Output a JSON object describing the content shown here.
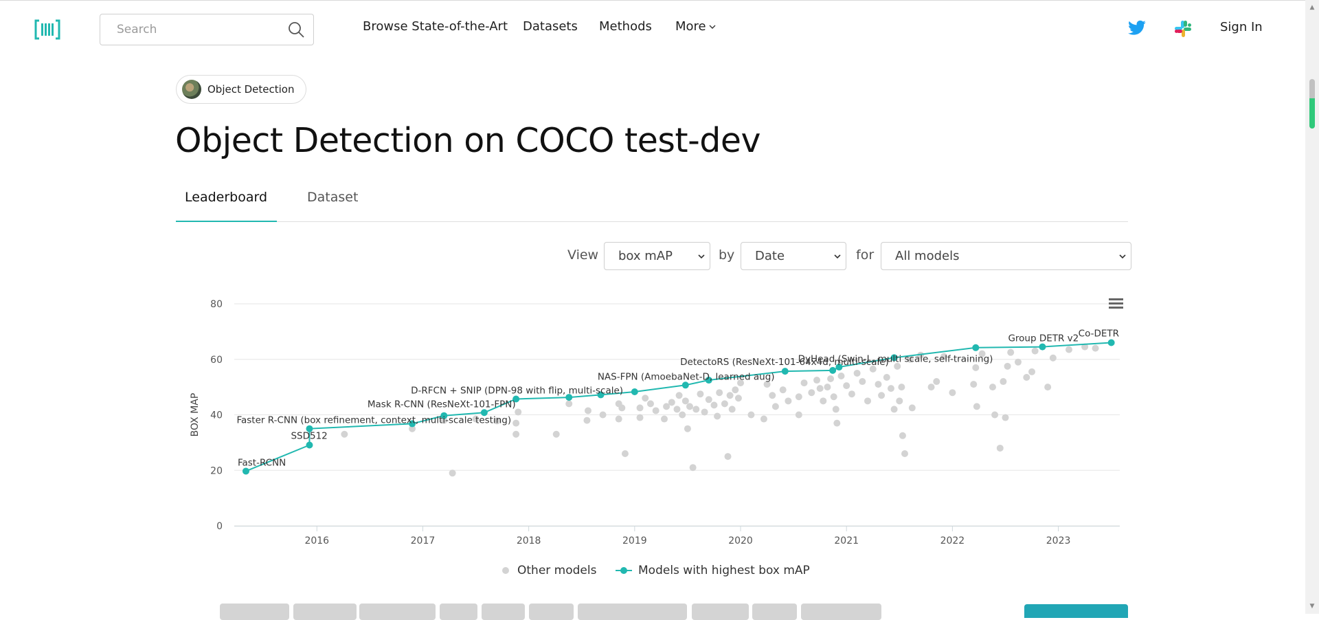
{
  "navbar": {
    "search_placeholder": "Search",
    "links": [
      "Browse State-of-the-Art",
      "Datasets",
      "Methods",
      "More"
    ],
    "signin": "Sign In"
  },
  "breadcrumb": {
    "label": "Object Detection"
  },
  "page": {
    "title": "Object Detection on COCO test-dev"
  },
  "tabs": [
    {
      "label": "Leaderboard",
      "active": true
    },
    {
      "label": "Dataset",
      "active": false
    }
  ],
  "controls": {
    "view_label": "View",
    "view_value": "box mAP",
    "by_label": "by",
    "by_value": "Date",
    "for_label": "for",
    "for_value": "All models"
  },
  "colors": {
    "accent": "#21b8b0",
    "other_models": "#d3d3d3",
    "axis_text": "#555555"
  },
  "chart_data": {
    "type": "scatter",
    "ylabel": "BOX MAP",
    "xlabel": "",
    "ylim": [
      0,
      80
    ],
    "yticks": [
      0,
      20,
      40,
      60,
      80
    ],
    "xticks": [
      "2016",
      "2017",
      "2018",
      "2019",
      "2020",
      "2021",
      "2022",
      "2023"
    ],
    "xlim": [
      "2015.22",
      "2023.58"
    ],
    "grid": true,
    "legend_position": "bottom",
    "legend": [
      "Other models",
      "Models with highest box mAP"
    ],
    "sota_series": {
      "name": "Models with highest box mAP",
      "x": [
        "2015.33",
        "2015.93",
        "2015.93",
        "2016.90",
        "2017.20",
        "2017.58",
        "2017.88",
        "2018.38",
        "2018.68",
        "2019.00",
        "2019.48",
        "2019.70",
        "2020.42",
        "2020.87",
        "2020.93",
        "2021.45",
        "2022.22",
        "2022.85",
        "2023.50"
      ],
      "y": [
        19.7,
        29.1,
        35.0,
        36.8,
        39.7,
        40.8,
        45.7,
        46.3,
        47.2,
        48.3,
        50.7,
        52.5,
        55.7,
        56.0,
        57.2,
        60.6,
        64.2,
        64.5,
        66.0
      ]
    },
    "labels": [
      {
        "text": "Fast-RCNN",
        "x": "2015.33",
        "y": 19.7
      },
      {
        "text": "SSD512",
        "x": "2015.93",
        "y": 29.1
      },
      {
        "text": "Faster R-CNN (box refinement, context, multi-scale testing)",
        "x": "2015.93",
        "y": 35.0
      },
      {
        "text": "Mask R-CNN (ResNeXt-101-FPN)",
        "x": "2017.58",
        "y": 40.8
      },
      {
        "text": "D-RFCN + SNIP (DPN-98 with flip, multi-scale)",
        "x": "2017.88",
        "y": 45.7
      },
      {
        "text": "NAS-FPN (AmoebaNet-D, learned aug)",
        "x": "2019.48",
        "y": 50.7
      },
      {
        "text": "DetectoRS (ResNeXt-101-64x4d, multi-scale)",
        "x": "2020.87",
        "y": 56.0
      },
      {
        "text": "DyHead (Swin-L, multi scale, self-training)",
        "x": "2021.45",
        "y": 60.6
      },
      {
        "text": "Group DETR v2",
        "x": "2022.85",
        "y": 64.5
      },
      {
        "text": "Co-DETR",
        "x": "2023.50",
        "y": 66.0
      }
    ],
    "other_models": {
      "name": "Other models",
      "points": [
        [
          "2016.26",
          33.0
        ],
        [
          "2016.90",
          35.0
        ],
        [
          "2017.20",
          38.0
        ],
        [
          "2017.28",
          19.0
        ],
        [
          "2017.50",
          38.5
        ],
        [
          "2017.70",
          37.8
        ],
        [
          "2017.88",
          33.0
        ],
        [
          "2017.88",
          37.0
        ],
        [
          "2017.90",
          41.0
        ],
        [
          "2018.26",
          33.0
        ],
        [
          "2018.38",
          44.0
        ],
        [
          "2018.55",
          38.0
        ],
        [
          "2018.56",
          41.5
        ],
        [
          "2018.70",
          40.0
        ],
        [
          "2018.85",
          44.0
        ],
        [
          "2018.85",
          38.5
        ],
        [
          "2018.88",
          42.5
        ],
        [
          "2018.91",
          26.0
        ],
        [
          "2019.05",
          42.5
        ],
        [
          "2019.05",
          39.0
        ],
        [
          "2019.10",
          46.0
        ],
        [
          "2019.15",
          44.0
        ],
        [
          "2019.20",
          41.5
        ],
        [
          "2019.28",
          38.5
        ],
        [
          "2019.30",
          43.0
        ],
        [
          "2019.35",
          44.5
        ],
        [
          "2019.40",
          42.0
        ],
        [
          "2019.42",
          47.0
        ],
        [
          "2019.45",
          40.0
        ],
        [
          "2019.48",
          45.0
        ],
        [
          "2019.50",
          35.0
        ],
        [
          "2019.52",
          43.0
        ],
        [
          "2019.55",
          21.0
        ],
        [
          "2019.58",
          42.0
        ],
        [
          "2019.62",
          47.5
        ],
        [
          "2019.66",
          41.0
        ],
        [
          "2019.70",
          45.5
        ],
        [
          "2019.75",
          43.5
        ],
        [
          "2019.78",
          39.5
        ],
        [
          "2019.80",
          48.0
        ],
        [
          "2019.85",
          44.0
        ],
        [
          "2019.88",
          25.0
        ],
        [
          "2019.90",
          47.0
        ],
        [
          "2019.92",
          42.0
        ],
        [
          "2019.95",
          49.0
        ],
        [
          "2019.98",
          46.0
        ],
        [
          "2020.00",
          51.5
        ],
        [
          "2020.10",
          40.0
        ],
        [
          "2020.22",
          38.5
        ],
        [
          "2020.25",
          51.0
        ],
        [
          "2020.30",
          47.0
        ],
        [
          "2020.33",
          43.0
        ],
        [
          "2020.40",
          49.0
        ],
        [
          "2020.45",
          45.0
        ],
        [
          "2020.55",
          46.5
        ],
        [
          "2020.55",
          40.0
        ],
        [
          "2020.60",
          51.5
        ],
        [
          "2020.67",
          48.0
        ],
        [
          "2020.72",
          52.5
        ],
        [
          "2020.75",
          49.5
        ],
        [
          "2020.78",
          45.0
        ],
        [
          "2020.82",
          50.0
        ],
        [
          "2020.85",
          53.0
        ],
        [
          "2020.88",
          46.5
        ],
        [
          "2020.90",
          42.0
        ],
        [
          "2020.91",
          37.0
        ],
        [
          "2020.95",
          54.0
        ],
        [
          "2021.00",
          50.5
        ],
        [
          "2021.05",
          47.5
        ],
        [
          "2021.10",
          55.0
        ],
        [
          "2021.15",
          52.0
        ],
        [
          "2021.20",
          45.0
        ],
        [
          "2021.25",
          56.5
        ],
        [
          "2021.30",
          51.0
        ],
        [
          "2021.33",
          47.0
        ],
        [
          "2021.38",
          53.5
        ],
        [
          "2021.42",
          49.5
        ],
        [
          "2021.45",
          42.0
        ],
        [
          "2021.48",
          57.5
        ],
        [
          "2021.50",
          45.0
        ],
        [
          "2021.52",
          50.0
        ],
        [
          "2021.53",
          32.5
        ],
        [
          "2021.55",
          26.0
        ],
        [
          "2021.60",
          60.0
        ],
        [
          "2021.62",
          42.5
        ],
        [
          "2021.70",
          61.5
        ],
        [
          "2021.80",
          50.0
        ],
        [
          "2021.85",
          52.0
        ],
        [
          "2021.92",
          61.0
        ],
        [
          "2022.00",
          48.0
        ],
        [
          "2022.20",
          51.0
        ],
        [
          "2022.22",
          57.0
        ],
        [
          "2022.23",
          43.0
        ],
        [
          "2022.28",
          62.0
        ],
        [
          "2022.38",
          50.0
        ],
        [
          "2022.40",
          40.0
        ],
        [
          "2022.45",
          28.0
        ],
        [
          "2022.48",
          52.0
        ],
        [
          "2022.50",
          39.0
        ],
        [
          "2022.52",
          57.5
        ],
        [
          "2022.55",
          62.5
        ],
        [
          "2022.62",
          59.0
        ],
        [
          "2022.70",
          53.5
        ],
        [
          "2022.75",
          55.5
        ],
        [
          "2022.78",
          63.0
        ],
        [
          "2022.90",
          50.0
        ],
        [
          "2022.95",
          60.5
        ],
        [
          "2023.10",
          63.5
        ],
        [
          "2023.25",
          64.5
        ],
        [
          "2023.35",
          64.0
        ]
      ]
    }
  }
}
